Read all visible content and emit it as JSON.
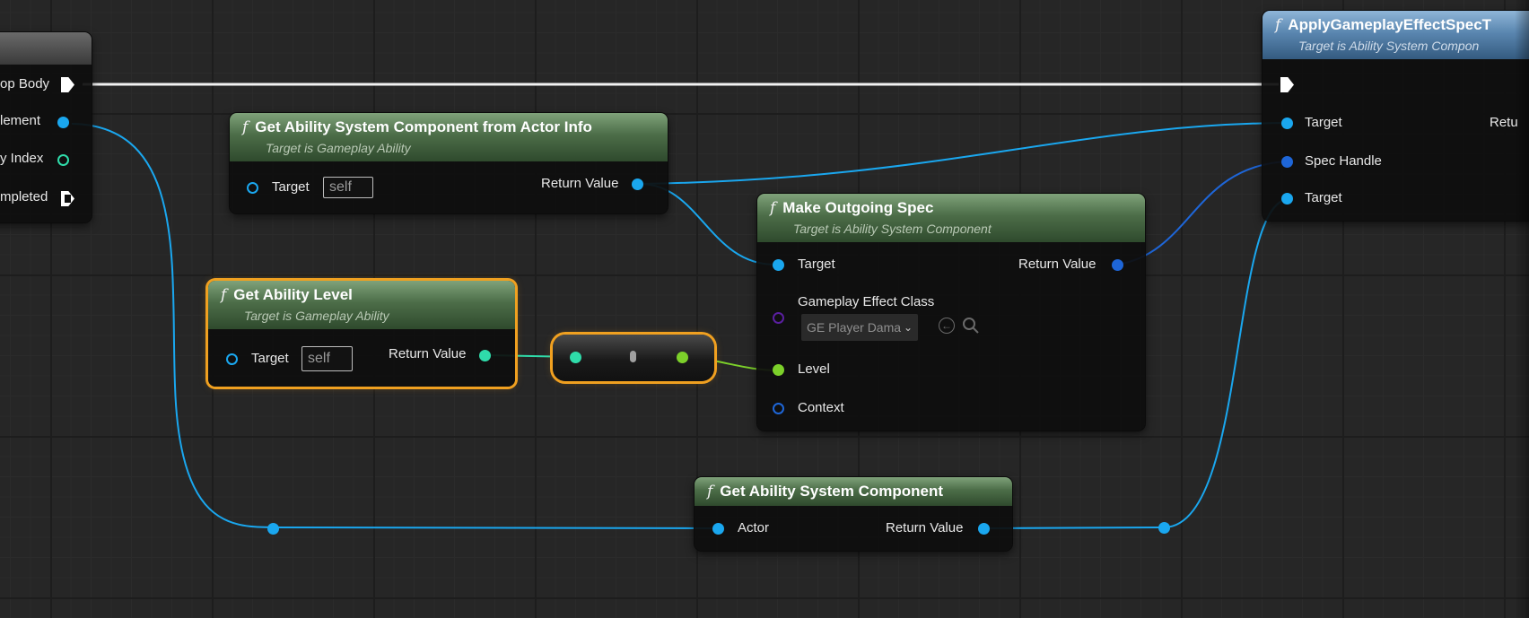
{
  "left_node": {
    "pins": [
      "op Body",
      "lement",
      "y Index",
      "mpleted"
    ]
  },
  "asc_from_actor_info": {
    "title": "Get Ability System Component from Actor Info",
    "subtitle": "Target is Gameplay Ability",
    "target_label": "Target",
    "target_value": "self",
    "return_label": "Return Value"
  },
  "get_ability_level": {
    "title": "Get Ability Level",
    "subtitle": "Target is Gameplay Ability",
    "target_label": "Target",
    "target_value": "self",
    "return_label": "Return Value"
  },
  "make_outgoing_spec": {
    "title": "Make Outgoing Spec",
    "subtitle": "Target is Ability System Component",
    "target_label": "Target",
    "return_label": "Return Value",
    "effect_class_label": "Gameplay Effect Class",
    "effect_class_value": "GE Player Dama",
    "level_label": "Level",
    "context_label": "Context"
  },
  "get_asc": {
    "title": "Get Ability System Component",
    "actor_label": "Actor",
    "return_label": "Return Value"
  },
  "apply_spec": {
    "title": "ApplyGameplayEffectSpecT",
    "subtitle": "Target is Ability System Compon",
    "target_label": "Target",
    "spec_handle_label": "Spec Handle",
    "target2_label": "Target",
    "return_label": "Retu"
  },
  "colors": {
    "object_pin": "#1aa7ef",
    "struct_pin": "#1e66d8",
    "float_pin": "#7cd02a",
    "int_pin": "#2fdcaa",
    "function_header": "#4c6d48",
    "selection": "#f0a020"
  }
}
